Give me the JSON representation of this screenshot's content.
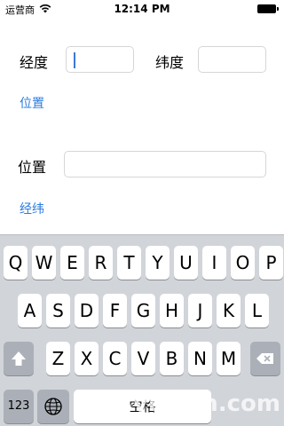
{
  "status_bar": {
    "carrier": "运营商",
    "time": "12:14 PM"
  },
  "form": {
    "longitude_label": "经度",
    "longitude_value": "",
    "latitude_label": "纬度",
    "latitude_value": "",
    "lookup_position_link": "位置",
    "position_label": "位置",
    "position_value": "",
    "lookup_coords_link": "经纬"
  },
  "keyboard": {
    "row1": [
      "Q",
      "W",
      "E",
      "R",
      "T",
      "Y",
      "U",
      "I",
      "O",
      "P"
    ],
    "row2": [
      "A",
      "S",
      "D",
      "F",
      "G",
      "H",
      "J",
      "K",
      "L"
    ],
    "row3": [
      "Z",
      "X",
      "C",
      "V",
      "B",
      "N",
      "M"
    ],
    "numbers_key": "123",
    "space_key": "空格",
    "globe_icon": "globe-icon",
    "shift_icon": "shift-arrow-icon",
    "delete_icon": "delete-backspace-icon"
  },
  "watermark": "yuslan.com",
  "colors": {
    "link": "#2b7be0",
    "cursor": "#3a78d6",
    "keyboard_bg": "#d1d4d9"
  }
}
